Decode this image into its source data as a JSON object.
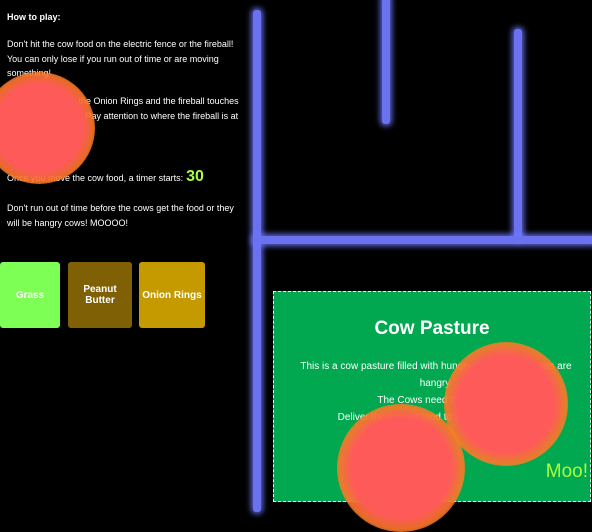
{
  "instructions": {
    "title": "How to play:",
    "p1": "Don't hit the cow food on the electric fence or the fireball! You can only lose if you run out of time or are moving something!",
    "p2": "If you are moving the Onion Rings and the fireball touches the other, you lose! Pay attention to where the fireball is at all times!",
    "p3": "Once you move the cow food, a timer starts:",
    "timer": "30",
    "p4": "Don't run out of time before the cows get the food or they will be hangry cows! MOOOO!"
  },
  "food_buttons": [
    {
      "label": "Grass",
      "color": "#7dff56"
    },
    {
      "label": "Peanut Butter",
      "color": "#806005"
    },
    {
      "label": "Onion Rings",
      "color": "#c59a00"
    }
  ],
  "pasture": {
    "title": "Cow Pasture",
    "desc_line1": "This is a cow pasture filled with hungry cows. Some cows are",
    "desc_line2": "hangry.",
    "desc_line3": "The Cows need their food!",
    "desc_line4": "Deliver the correct food to keep them happy!",
    "moo": "Moo!"
  },
  "colors": {
    "background": "#000000",
    "wall": "#6b72f0",
    "pasture": "#02a850",
    "fireball": "#ff5a5a",
    "accent": "#a8ff3e"
  }
}
